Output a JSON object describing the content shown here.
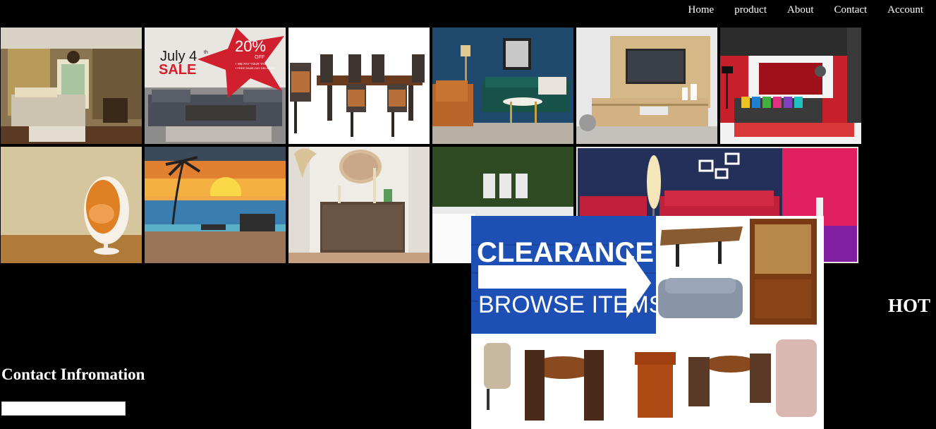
{
  "nav": {
    "items": [
      "Home",
      "product",
      "About",
      "Contact",
      "Account"
    ]
  },
  "gallery": {
    "row1": [
      "bedroom-photo",
      "july-4th-sale-banner",
      "dining-set-photo",
      "blue-living-room-photo",
      "tv-stand-photo",
      "red-living-room-photo"
    ],
    "row2": [
      "egg-chair-photo",
      "sunset-beach-photo",
      "sideboard-photo",
      "green-room-photo",
      "red-sofa-photo"
    ]
  },
  "sale_banner": {
    "line1": "July 4",
    "sup": "th",
    "line2": "SALE",
    "percent": "20%",
    "off": "OFF",
    "fine1": "+ WE PAY YOUR TAX",
    "fine2": "+ FREE SAME-DAY DELIVERY"
  },
  "clearance": {
    "title": "CLEARANCE",
    "subtitle": "BROWSE ITEMS"
  },
  "hot_label": "HOT",
  "contact": {
    "title": "Contact Infromation",
    "input_value": ""
  },
  "colors": {
    "background": "#000000",
    "sale_red": "#d0202e",
    "clearance_blue": "#1e4fb4",
    "blue_wall": "#1f4a6e",
    "red_wall": "#c8202a",
    "green_wall": "#2d4a22",
    "navy_wall": "#25305a"
  }
}
